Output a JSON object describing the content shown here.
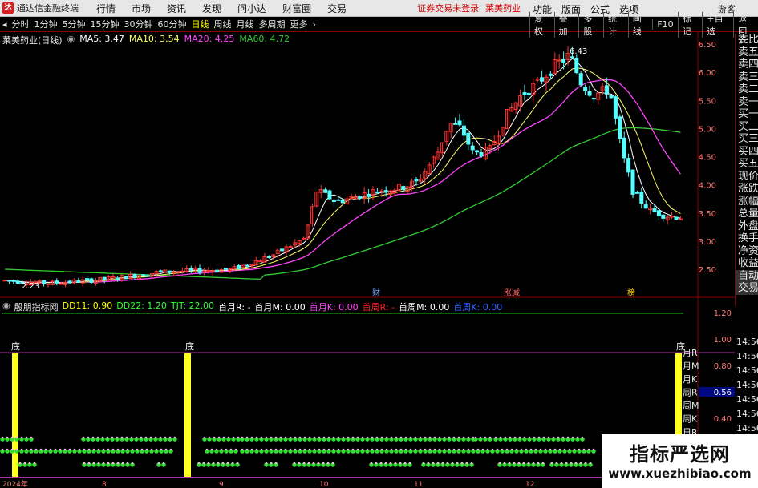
{
  "app": {
    "name": "通达信金融终端",
    "warning": "证券交易未登录",
    "stock": "莱美药业",
    "guest": "游客"
  },
  "menus": [
    "行情",
    "市场",
    "资讯",
    "发现",
    "问小达",
    "财富圈",
    "交易"
  ],
  "right_menus": [
    "功能",
    "版面",
    "公式",
    "选项"
  ],
  "toolbar": {
    "periods": [
      "分时",
      "1分钟",
      "5分钟",
      "15分钟",
      "30分钟",
      "60分钟",
      "日线",
      "周线",
      "月线",
      "多周期",
      "更多"
    ],
    "active": "日线",
    "right": [
      "复权",
      "叠加",
      "多股",
      "统计",
      "画线",
      "F10",
      "标记",
      "+自选",
      "返回"
    ]
  },
  "main_legend": {
    "name": "莱美药业(日线)",
    "items": [
      {
        "label": "MA5: 3.47",
        "color": "#ffffff"
      },
      {
        "label": "MA10: 3.54",
        "color": "#ffff66"
      },
      {
        "label": "MA20: 4.25",
        "color": "#ff44ff"
      },
      {
        "label": "MA60: 4.72",
        "color": "#33cc33"
      }
    ]
  },
  "sub_legend": {
    "name": "殷朋指标网",
    "items": [
      {
        "label": "DD11: 0.90",
        "color": "#ffff00"
      },
      {
        "label": "DD22: 1.20",
        "color": "#33ff33"
      },
      {
        "label": "TJT: 22.00",
        "color": "#33ff33"
      },
      {
        "label": "首月R: -",
        "color": "#ffffff"
      },
      {
        "label": "首月M: 0.00",
        "color": "#ffffff"
      },
      {
        "label": "首月K: 0.00",
        "color": "#ff44ff"
      },
      {
        "label": "首周R: -",
        "color": "#ff2222"
      },
      {
        "label": "首周M: 0.00",
        "color": "#ffffff"
      },
      {
        "label": "首周K: 0.00",
        "color": "#3366ff"
      }
    ]
  },
  "price_axis": [
    "6.50",
    "6.00",
    "5.50",
    "5.00",
    "4.50",
    "4.00",
    "3.50",
    "3.00",
    "2.50"
  ],
  "sub_axis": [
    "1.20",
    "1.00",
    "0.80",
    "0.56",
    "0.40"
  ],
  "sub_axis_hl": "0.56",
  "sub_right_labels": [
    "月R",
    "月M",
    "月K",
    "周R",
    "周M",
    "周K",
    "日R"
  ],
  "sidebar": [
    "委比",
    "卖五",
    "卖四",
    "卖三",
    "卖二",
    "卖一",
    "买一",
    "买二",
    "买三",
    "买四",
    "买五",
    "现价",
    "涨跌",
    "涨幅",
    "总量",
    "外盘",
    "换手",
    "净资",
    "收益",
    "自动",
    "交易"
  ],
  "times": [
    "14:56",
    "14:56",
    "14:56",
    "14:56",
    "14:56",
    "14:56",
    "14:56"
  ],
  "bottom_axis": [
    "2024年",
    "8",
    "9",
    "10",
    "11",
    "12"
  ],
  "annotations": {
    "high": "6.43",
    "low": "2.23",
    "m1": "财",
    "m2": "涨减",
    "m3": "榜",
    "di": "底"
  },
  "watermark": {
    "title": "指标严选网",
    "url": "www.xuezhibiao.com"
  },
  "chart_data": {
    "type": "candlestick",
    "ylim": [
      2.1,
      6.7
    ],
    "high": 6.43,
    "low": 2.23,
    "ma": {
      "MA5": 3.47,
      "MA10": 3.54,
      "MA20": 4.25,
      "MA60": 4.72
    }
  }
}
